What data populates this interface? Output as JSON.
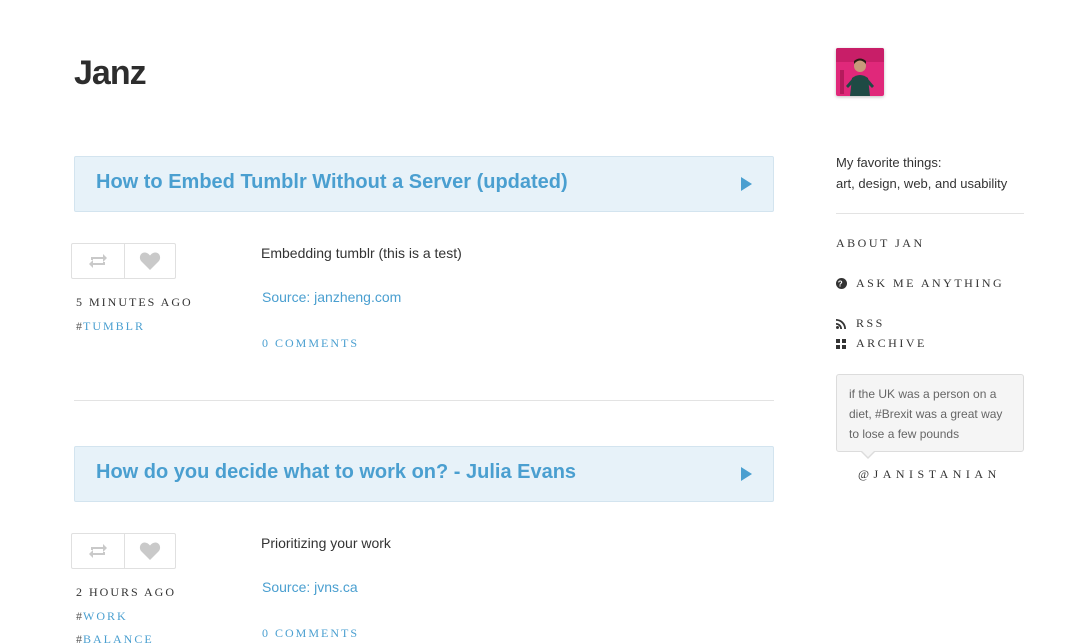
{
  "blog": {
    "title": "Janz"
  },
  "posts": [
    {
      "title": "How to Embed Tumblr Without a Server (updated)",
      "caption": "Embedding tumblr (this is a test)",
      "source": "Source: janzheng.com",
      "time": "5 minutes ago",
      "tags": [
        "tumblr"
      ],
      "comments": "0 comments"
    },
    {
      "title": "How do you decide what to work on? - Julia Evans",
      "caption": "Prioritizing your work",
      "source": "Source: jvns.ca",
      "time": "2 hours ago",
      "tags": [
        "work",
        "balance"
      ],
      "comments": "0 comments"
    }
  ],
  "tag_prefix": "#",
  "sidebar": {
    "description_line1": "My favorite things:",
    "description_line2": "art, design, web, and usability",
    "links": {
      "about": "About Jan",
      "ask": "Ask me anything",
      "rss": "RSS",
      "archive": "Archive"
    },
    "tweet": "if the UK was a person on a diet, #Brexit was a great way to lose a few pounds",
    "twitter_handle": "@janistanian"
  },
  "colors": {
    "accent": "#4a9fd0",
    "link_box_bg": "#e7f2f9"
  },
  "icons": {
    "reblog": "reblog-icon",
    "like": "heart-icon",
    "ask": "question-circle-icon",
    "rss": "rss-icon",
    "archive": "grid-icon",
    "post_arrow": "play-arrow-icon"
  }
}
